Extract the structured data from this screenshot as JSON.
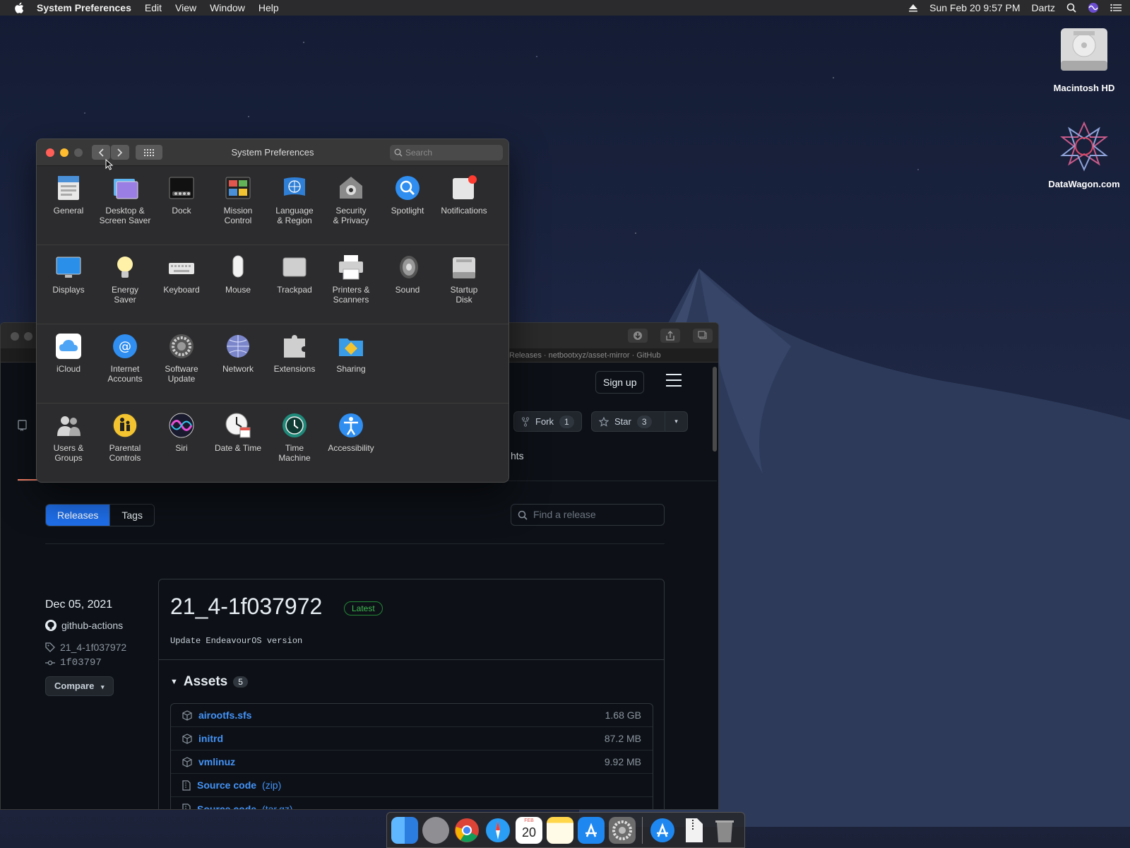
{
  "menubar": {
    "app_name": "System Preferences",
    "menus": [
      "Edit",
      "View",
      "Window",
      "Help"
    ],
    "datetime": "Sun Feb 20  9:57 PM",
    "user": "Dartz"
  },
  "desktop": {
    "icons": [
      {
        "label": "Macintosh HD",
        "icon": "hard-drive-icon"
      },
      {
        "label": "DataWagon.com",
        "icon": "datawagon-logo-icon"
      }
    ]
  },
  "sysprefs": {
    "title": "System Preferences",
    "search_placeholder": "Search",
    "rows": [
      [
        {
          "label": "General",
          "icon": "general-icon"
        },
        {
          "label": "Desktop &\nScreen Saver",
          "icon": "desktop-icon"
        },
        {
          "label": "Dock",
          "icon": "dock-icon"
        },
        {
          "label": "Mission\nControl",
          "icon": "mission-control-icon"
        },
        {
          "label": "Language\n& Region",
          "icon": "globe-flag-icon"
        },
        {
          "label": "Security\n& Privacy",
          "icon": "security-house-icon"
        },
        {
          "label": "Spotlight",
          "icon": "spotlight-icon"
        },
        {
          "label": "Notifications",
          "icon": "notifications-icon"
        }
      ],
      [
        {
          "label": "Displays",
          "icon": "display-icon"
        },
        {
          "label": "Energy\nSaver",
          "icon": "lightbulb-icon"
        },
        {
          "label": "Keyboard",
          "icon": "keyboard-icon"
        },
        {
          "label": "Mouse",
          "icon": "mouse-icon"
        },
        {
          "label": "Trackpad",
          "icon": "trackpad-icon"
        },
        {
          "label": "Printers &\nScanners",
          "icon": "printer-icon"
        },
        {
          "label": "Sound",
          "icon": "speaker-icon"
        },
        {
          "label": "Startup\nDisk",
          "icon": "startup-disk-icon"
        }
      ],
      [
        {
          "label": "iCloud",
          "icon": "icloud-icon"
        },
        {
          "label": "Internet\nAccounts",
          "icon": "at-sign-icon"
        },
        {
          "label": "Software\nUpdate",
          "icon": "gear-icon"
        },
        {
          "label": "Network",
          "icon": "network-globe-icon"
        },
        {
          "label": "Extensions",
          "icon": "puzzle-icon"
        },
        {
          "label": "Sharing",
          "icon": "sharing-folder-icon"
        }
      ],
      [
        {
          "label": "Users &\nGroups",
          "icon": "users-icon"
        },
        {
          "label": "Parental\nControls",
          "icon": "parental-controls-icon"
        },
        {
          "label": "Siri",
          "icon": "siri-icon"
        },
        {
          "label": "Date & Time",
          "icon": "clock-calendar-icon"
        },
        {
          "label": "Time\nMachine",
          "icon": "time-machine-icon"
        },
        {
          "label": "Accessibility",
          "icon": "accessibility-icon"
        }
      ]
    ]
  },
  "browser": {
    "tab_title": "Releases · netbootxyz/asset-mirror · GitHub",
    "signup_label": "Sign up",
    "fork_label": "Fork",
    "fork_count": "1",
    "star_label": "Star",
    "star_count": "3",
    "partial_tab_text": "hts",
    "releases_tab": "Releases",
    "tags_tab": "Tags",
    "find_placeholder": "Find a release",
    "release": {
      "date": "Dec 05, 2021",
      "author": "github-actions",
      "tag": "21_4-1f037972",
      "commit": "1f03797",
      "compare_label": "Compare",
      "title": "21_4-1f037972",
      "badge": "Latest",
      "description": "Update EndeavourOS version",
      "assets_label": "Assets",
      "assets_count": "5",
      "assets": [
        {
          "name": "airootfs.sfs",
          "size": "1.68 GB"
        },
        {
          "name": "initrd",
          "size": "87.2 MB"
        },
        {
          "name": "vmlinuz",
          "size": "9.92 MB"
        },
        {
          "name": "Source code",
          "suffix": "(zip)",
          "size": ""
        },
        {
          "name": "Source code",
          "suffix": "(tar.gz)",
          "size": ""
        }
      ]
    }
  },
  "dock": {
    "items": [
      "finder-icon",
      "launchpad-icon",
      "chrome-icon",
      "safari-icon",
      "calendar-icon",
      "notes-icon",
      "app-store-icon",
      "system-preferences-icon",
      "app-store-2-icon",
      "archive-file-icon",
      "trash-icon"
    ],
    "calendar_day": "20",
    "calendar_month": "FEB"
  }
}
